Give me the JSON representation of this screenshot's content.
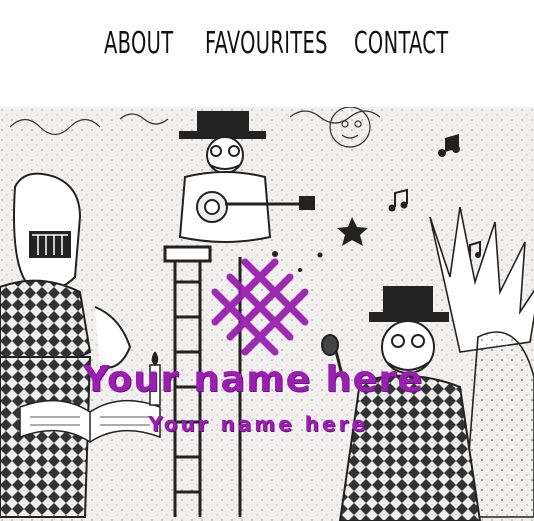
{
  "nav": {
    "about": "ABOUT",
    "favourites": "FAVOURITES",
    "contact": "CONTACT"
  },
  "hero": {
    "title": "Your name here",
    "subtitle": "Your name here",
    "accent_color": "#9a1fb0"
  },
  "icons": {
    "logo": "hash-cross-logo-icon"
  }
}
